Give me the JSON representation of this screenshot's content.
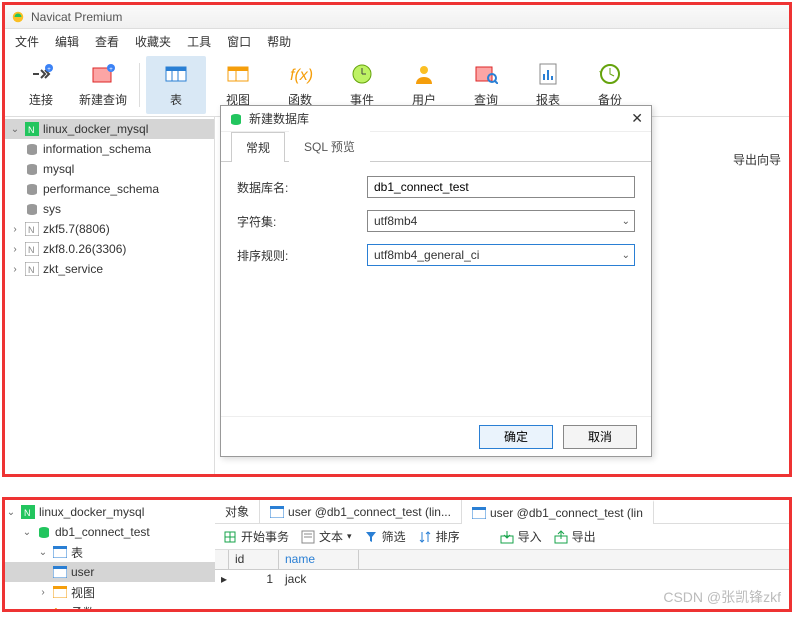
{
  "app": {
    "title": "Navicat Premium"
  },
  "menu": {
    "file": "文件",
    "edit": "编辑",
    "view": "查看",
    "favorites": "收藏夹",
    "tools": "工具",
    "window": "窗口",
    "help": "帮助"
  },
  "toolbar": {
    "connect": "连接",
    "newquery": "新建查询",
    "table": "表",
    "view": "视图",
    "function": "函数",
    "event": "事件",
    "user": "用户",
    "query": "查询",
    "report": "报表",
    "backup": "备份"
  },
  "tree": {
    "conn1": "linux_docker_mysql",
    "db_info": "information_schema",
    "db_mysql": "mysql",
    "db_perf": "performance_schema",
    "db_sys": "sys",
    "conn2": "zkf5.7(8806)",
    "conn3": "zkf8.0.26(3306)",
    "conn4": "zkt_service"
  },
  "rightpane": {
    "export_hint": "导出向导"
  },
  "dialog": {
    "title": "新建数据库",
    "tab_general": "常规",
    "tab_sql": "SQL 预览",
    "lbl_dbname": "数据库名:",
    "val_dbname": "db1_connect_test",
    "lbl_charset": "字符集:",
    "val_charset": "utf8mb4",
    "lbl_collation": "排序规则:",
    "val_collation": "utf8mb4_general_ci",
    "btn_ok": "确定",
    "btn_cancel": "取消"
  },
  "panel2": {
    "tree": {
      "conn": "linux_docker_mysql",
      "db1": "db1_connect_test",
      "tables": "表",
      "user": "user",
      "views": "视图",
      "funcs": "函数"
    },
    "tabs": {
      "objects": "对象",
      "user1": "user @db1_connect_test (lin...",
      "user2": "user @db1_connect_test (lin"
    },
    "tb2": {
      "begin": "开始事务",
      "text": "文本",
      "filter": "筛选",
      "sort": "排序",
      "import": "导入",
      "export": "导出"
    },
    "grid": {
      "col_id": "id",
      "col_name": "name",
      "row1_id": "1",
      "row1_name": "jack"
    }
  },
  "watermark": "CSDN @张凯锋zkf"
}
